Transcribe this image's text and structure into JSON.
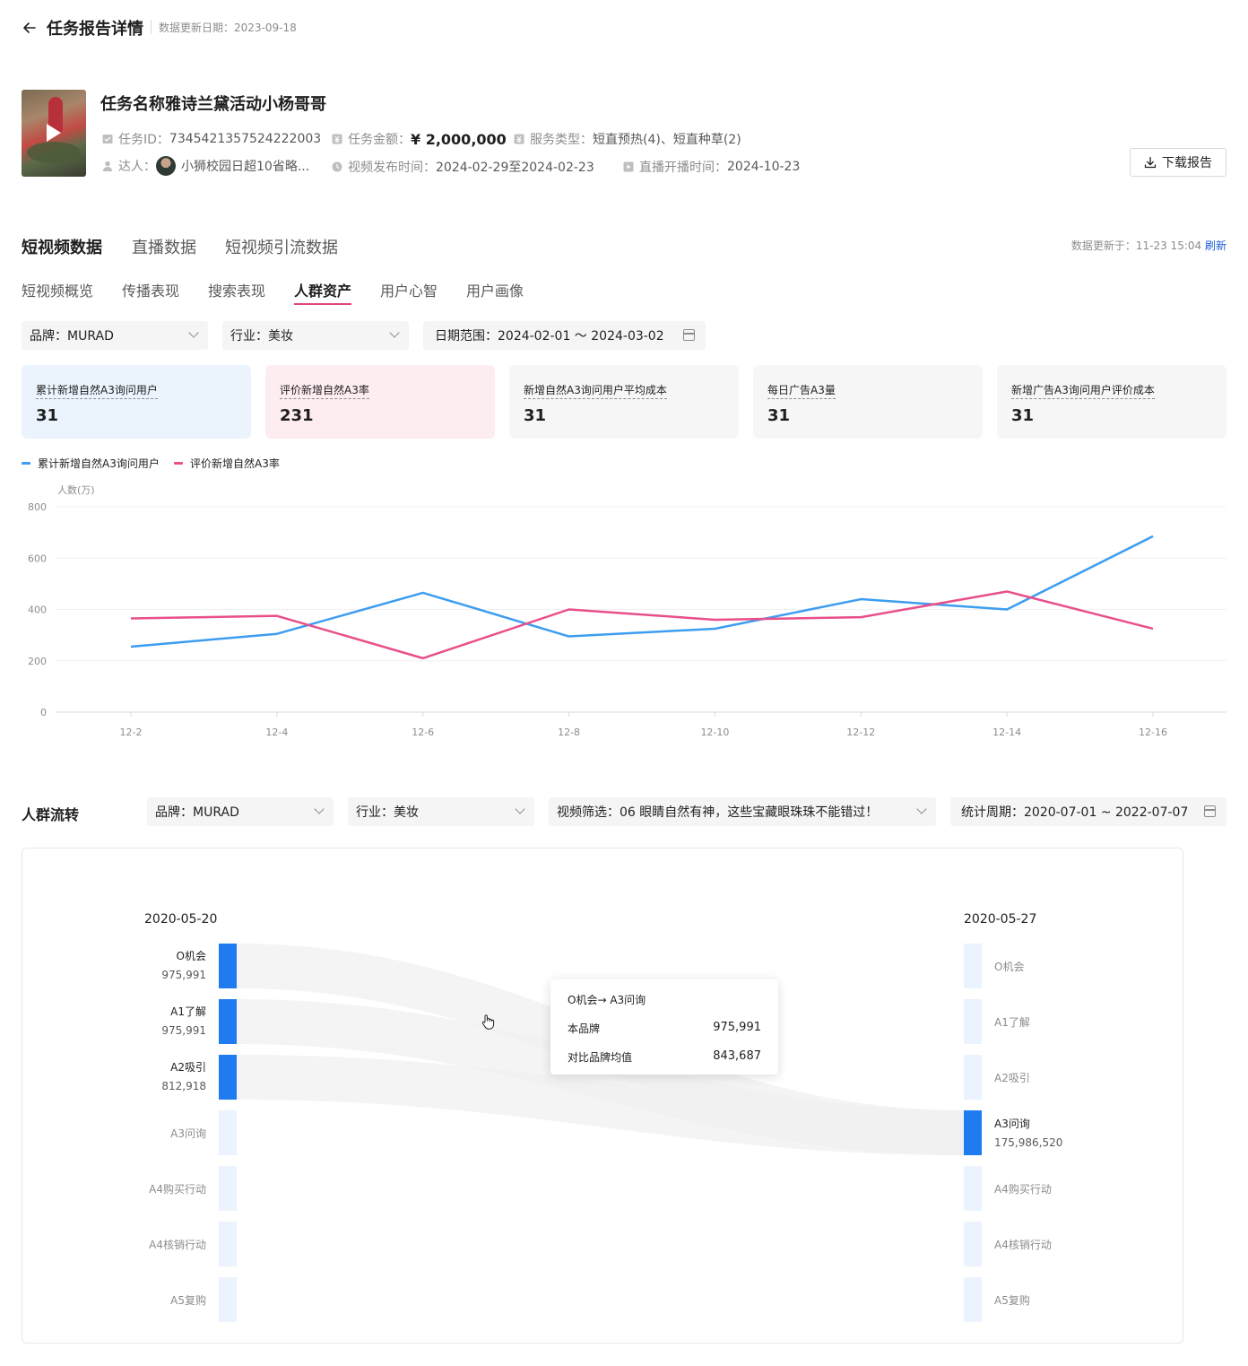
{
  "header": {
    "title": "任务报告详情",
    "update_date": "数据更新日期：2023-09-18"
  },
  "task": {
    "name": "任务名称雅诗兰黛活动小杨哥哥",
    "id_label": "任务ID：",
    "id_value": "7345421357524222003",
    "amount_label": "任务金额：",
    "amount_value": "¥ 2,000,000",
    "service_label": "服务类型：",
    "service_value": "短直预热(4)、短直种草(2)",
    "talent_label": "达人：",
    "talent_value": "小狮校园日超10省略...",
    "video_time_label": "视频发布时间：",
    "video_time_value": "2024-02-29至2024-02-23",
    "live_time_label": "直播开播时间：",
    "live_time_value": "2024-10-23",
    "download_label": "下载报告"
  },
  "main_tabs": [
    "短视频数据",
    "直播数据",
    "短视频引流数据"
  ],
  "refresh": {
    "text": "数据更新于：11-23 15:04",
    "link": "刷新"
  },
  "sub_tabs": [
    "短视频概览",
    "传播表现",
    "搜索表现",
    "人群资产",
    "用户心智",
    "用户画像"
  ],
  "filters": {
    "brand": "品牌：MURAD",
    "industry": "行业：美妆",
    "date_range": "日期范围：2024-02-01 ～ 2024-03-02"
  },
  "kpis": [
    {
      "label": "累计新增自然A3询问用户",
      "value": "31"
    },
    {
      "label": "评价新增自然A3率",
      "value": "231"
    },
    {
      "label": "新增自然A3询问用户平均成本",
      "value": "31"
    },
    {
      "label": "每日广告A3量",
      "value": "31"
    },
    {
      "label": "新增广告A3询问用户评价成本",
      "value": "31"
    }
  ],
  "colors": {
    "accent_pink": "#e0457b",
    "series_blue": "#3d9df0",
    "series_pink": "#e94f8a",
    "bar_active": "#1e7bf0",
    "bar_idle": "#eaf3fe",
    "link_blue": "#1d5bd6"
  },
  "chart_data": {
    "type": "line",
    "ylabel": "人数(万)",
    "ylim": [
      0,
      800
    ],
    "yticks": [
      "0",
      "200",
      "400",
      "600",
      "800"
    ],
    "categories": [
      "12-2",
      "12-4",
      "12-6",
      "12-8",
      "12-10",
      "12-12",
      "12-14",
      "12-16"
    ],
    "series": [
      {
        "name": "累计新增自然A3询问用户",
        "color": "#3d9df0",
        "values": [
          255,
          305,
          465,
          295,
          325,
          440,
          400,
          685
        ]
      },
      {
        "name": "评价新增自然A3率",
        "color": "#e94f8a",
        "values": [
          365,
          375,
          210,
          400,
          360,
          370,
          470,
          325
        ]
      }
    ],
    "grid": true,
    "legend": "top-left"
  },
  "flow": {
    "title": "人群流转",
    "brand": "品牌：MURAD",
    "industry": "行业：美妆",
    "video_filter": "视频筛选：06 眼睛自然有神，这些宝藏眼珠珠不能错过！",
    "period": "统计周期：2020-07-01  ~ 2022-07-07",
    "left_date": "2020-05-20",
    "right_date": "2020-05-27",
    "left_stages": [
      {
        "name": "O机会",
        "value": "975,991"
      },
      {
        "name": "A1了解",
        "value": "975,991"
      },
      {
        "name": "A2吸引",
        "value": "812,918"
      },
      {
        "name": "A3问询",
        "value": ""
      },
      {
        "name": "A4购买行动",
        "value": ""
      },
      {
        "name": "A4核销行动",
        "value": ""
      },
      {
        "name": "A5复购",
        "value": ""
      }
    ],
    "right_stages": [
      {
        "name": "O机会",
        "value": ""
      },
      {
        "name": "A1了解",
        "value": ""
      },
      {
        "name": "A2吸引",
        "value": ""
      },
      {
        "name": "A3问询",
        "value": "175,986,520"
      },
      {
        "name": "A4购买行动",
        "value": ""
      },
      {
        "name": "A4核销行动",
        "value": ""
      },
      {
        "name": "A5复购",
        "value": ""
      }
    ],
    "tooltip": {
      "title": "O机会→ A3问询",
      "row1_label": "本品牌",
      "row1_value": "975,991",
      "row2_label": "对比品牌均值",
      "row2_value": "843,687"
    }
  }
}
